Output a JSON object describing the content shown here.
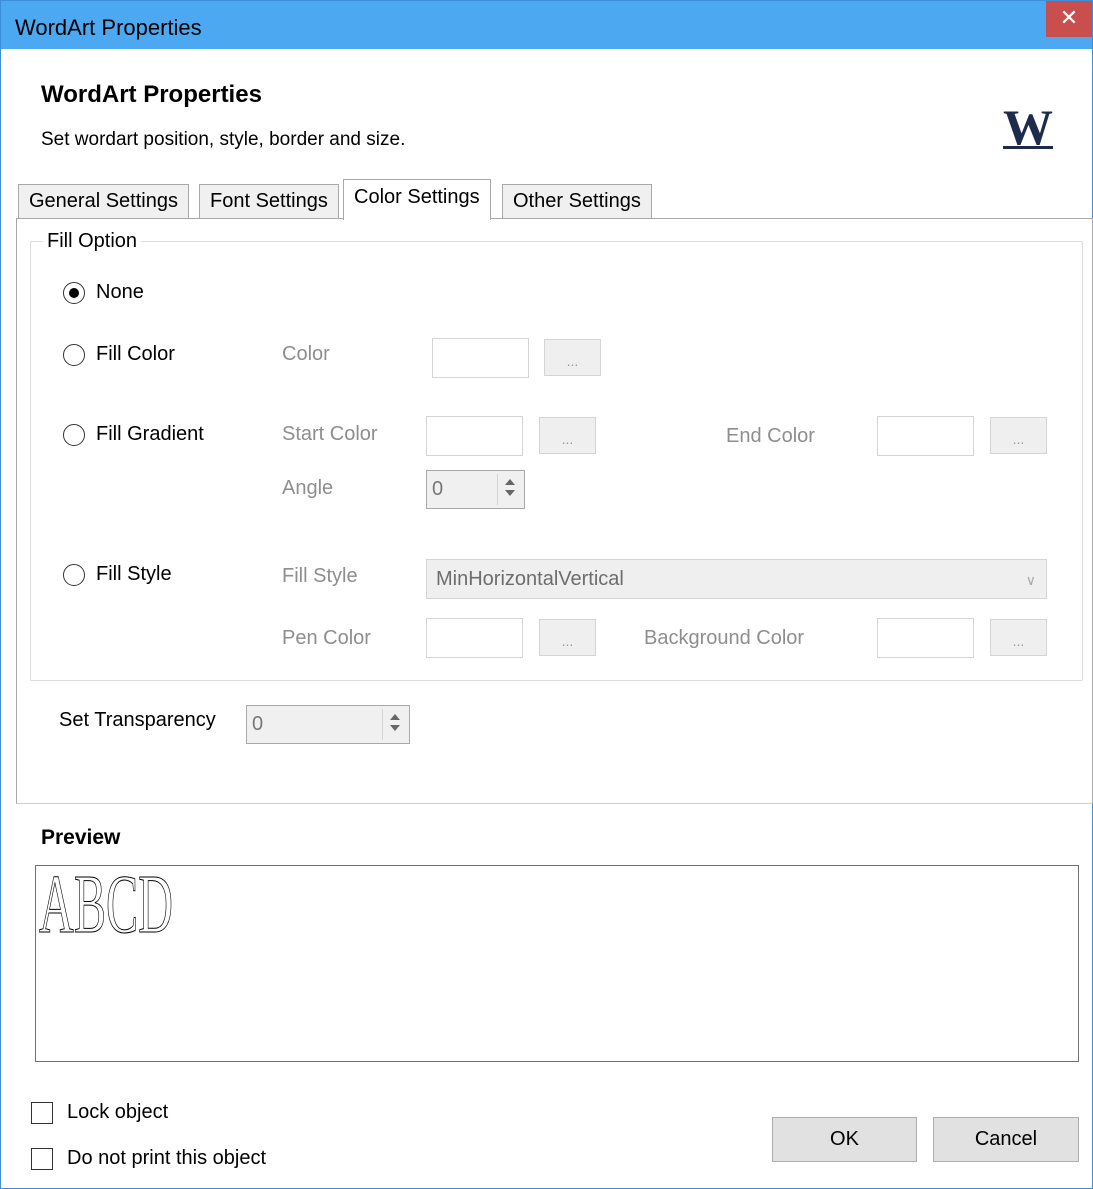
{
  "window": {
    "title": "WordArt Properties",
    "close_glyph": "✕"
  },
  "header": {
    "title": "WordArt Properties",
    "subtitle": "Set wordart position, style, border and size.",
    "logo_letter": "W"
  },
  "tabs": [
    {
      "label": "General Settings",
      "active": false
    },
    {
      "label": "Font Settings",
      "active": false
    },
    {
      "label": "Color Settings",
      "active": true
    },
    {
      "label": "Other Settings",
      "active": false
    }
  ],
  "fill_option": {
    "legend": "Fill Option",
    "none_label": "None",
    "selected": "None",
    "fill_color": {
      "label": "Fill Color",
      "color_label": "Color",
      "button": "..."
    },
    "fill_gradient": {
      "label": "Fill Gradient",
      "start_color_label": "Start Color",
      "end_color_label": "End Color",
      "angle_label": "Angle",
      "angle_value": "0",
      "button": "..."
    },
    "fill_style": {
      "label": "Fill Style",
      "style_label": "Fill Style",
      "style_value": "MinHorizontalVertical",
      "pen_color_label": "Pen Color",
      "background_color_label": "Background Color",
      "button": "..."
    }
  },
  "transparency": {
    "label": "Set Transparency",
    "value": "0"
  },
  "preview": {
    "title": "Preview",
    "text": "ABCD"
  },
  "options": {
    "lock_label": "Lock object",
    "no_print_label": "Do not print this object",
    "lock_checked": false,
    "no_print_checked": false
  },
  "buttons": {
    "ok": "OK",
    "cancel": "Cancel"
  },
  "colors": {
    "titlebar": "#4ca8f0",
    "close": "#c94f4f",
    "disabled_text": "#8e8e8e",
    "logo": "#1f2b4d"
  }
}
